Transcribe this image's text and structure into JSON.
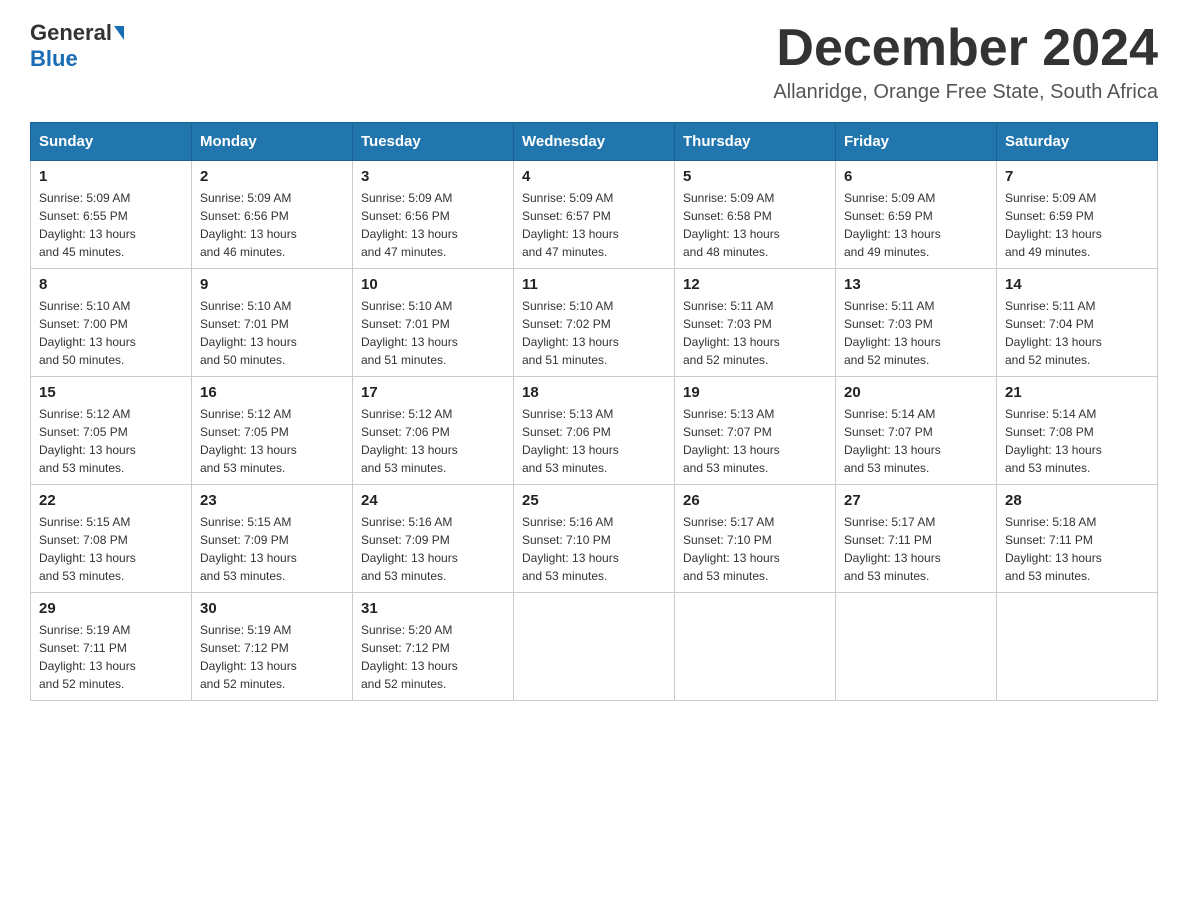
{
  "header": {
    "logo_general": "General",
    "logo_blue": "Blue",
    "month_title": "December 2024",
    "location": "Allanridge, Orange Free State, South Africa"
  },
  "days_of_week": [
    "Sunday",
    "Monday",
    "Tuesday",
    "Wednesday",
    "Thursday",
    "Friday",
    "Saturday"
  ],
  "weeks": [
    [
      {
        "day": "1",
        "sunrise": "5:09 AM",
        "sunset": "6:55 PM",
        "daylight": "13 hours and 45 minutes."
      },
      {
        "day": "2",
        "sunrise": "5:09 AM",
        "sunset": "6:56 PM",
        "daylight": "13 hours and 46 minutes."
      },
      {
        "day": "3",
        "sunrise": "5:09 AM",
        "sunset": "6:56 PM",
        "daylight": "13 hours and 47 minutes."
      },
      {
        "day": "4",
        "sunrise": "5:09 AM",
        "sunset": "6:57 PM",
        "daylight": "13 hours and 47 minutes."
      },
      {
        "day": "5",
        "sunrise": "5:09 AM",
        "sunset": "6:58 PM",
        "daylight": "13 hours and 48 minutes."
      },
      {
        "day": "6",
        "sunrise": "5:09 AM",
        "sunset": "6:59 PM",
        "daylight": "13 hours and 49 minutes."
      },
      {
        "day": "7",
        "sunrise": "5:09 AM",
        "sunset": "6:59 PM",
        "daylight": "13 hours and 49 minutes."
      }
    ],
    [
      {
        "day": "8",
        "sunrise": "5:10 AM",
        "sunset": "7:00 PM",
        "daylight": "13 hours and 50 minutes."
      },
      {
        "day": "9",
        "sunrise": "5:10 AM",
        "sunset": "7:01 PM",
        "daylight": "13 hours and 50 minutes."
      },
      {
        "day": "10",
        "sunrise": "5:10 AM",
        "sunset": "7:01 PM",
        "daylight": "13 hours and 51 minutes."
      },
      {
        "day": "11",
        "sunrise": "5:10 AM",
        "sunset": "7:02 PM",
        "daylight": "13 hours and 51 minutes."
      },
      {
        "day": "12",
        "sunrise": "5:11 AM",
        "sunset": "7:03 PM",
        "daylight": "13 hours and 52 minutes."
      },
      {
        "day": "13",
        "sunrise": "5:11 AM",
        "sunset": "7:03 PM",
        "daylight": "13 hours and 52 minutes."
      },
      {
        "day": "14",
        "sunrise": "5:11 AM",
        "sunset": "7:04 PM",
        "daylight": "13 hours and 52 minutes."
      }
    ],
    [
      {
        "day": "15",
        "sunrise": "5:12 AM",
        "sunset": "7:05 PM",
        "daylight": "13 hours and 53 minutes."
      },
      {
        "day": "16",
        "sunrise": "5:12 AM",
        "sunset": "7:05 PM",
        "daylight": "13 hours and 53 minutes."
      },
      {
        "day": "17",
        "sunrise": "5:12 AM",
        "sunset": "7:06 PM",
        "daylight": "13 hours and 53 minutes."
      },
      {
        "day": "18",
        "sunrise": "5:13 AM",
        "sunset": "7:06 PM",
        "daylight": "13 hours and 53 minutes."
      },
      {
        "day": "19",
        "sunrise": "5:13 AM",
        "sunset": "7:07 PM",
        "daylight": "13 hours and 53 minutes."
      },
      {
        "day": "20",
        "sunrise": "5:14 AM",
        "sunset": "7:07 PM",
        "daylight": "13 hours and 53 minutes."
      },
      {
        "day": "21",
        "sunrise": "5:14 AM",
        "sunset": "7:08 PM",
        "daylight": "13 hours and 53 minutes."
      }
    ],
    [
      {
        "day": "22",
        "sunrise": "5:15 AM",
        "sunset": "7:08 PM",
        "daylight": "13 hours and 53 minutes."
      },
      {
        "day": "23",
        "sunrise": "5:15 AM",
        "sunset": "7:09 PM",
        "daylight": "13 hours and 53 minutes."
      },
      {
        "day": "24",
        "sunrise": "5:16 AM",
        "sunset": "7:09 PM",
        "daylight": "13 hours and 53 minutes."
      },
      {
        "day": "25",
        "sunrise": "5:16 AM",
        "sunset": "7:10 PM",
        "daylight": "13 hours and 53 minutes."
      },
      {
        "day": "26",
        "sunrise": "5:17 AM",
        "sunset": "7:10 PM",
        "daylight": "13 hours and 53 minutes."
      },
      {
        "day": "27",
        "sunrise": "5:17 AM",
        "sunset": "7:11 PM",
        "daylight": "13 hours and 53 minutes."
      },
      {
        "day": "28",
        "sunrise": "5:18 AM",
        "sunset": "7:11 PM",
        "daylight": "13 hours and 53 minutes."
      }
    ],
    [
      {
        "day": "29",
        "sunrise": "5:19 AM",
        "sunset": "7:11 PM",
        "daylight": "13 hours and 52 minutes."
      },
      {
        "day": "30",
        "sunrise": "5:19 AM",
        "sunset": "7:12 PM",
        "daylight": "13 hours and 52 minutes."
      },
      {
        "day": "31",
        "sunrise": "5:20 AM",
        "sunset": "7:12 PM",
        "daylight": "13 hours and 52 minutes."
      },
      null,
      null,
      null,
      null
    ]
  ],
  "labels": {
    "sunrise": "Sunrise:",
    "sunset": "Sunset:",
    "daylight": "Daylight:"
  }
}
